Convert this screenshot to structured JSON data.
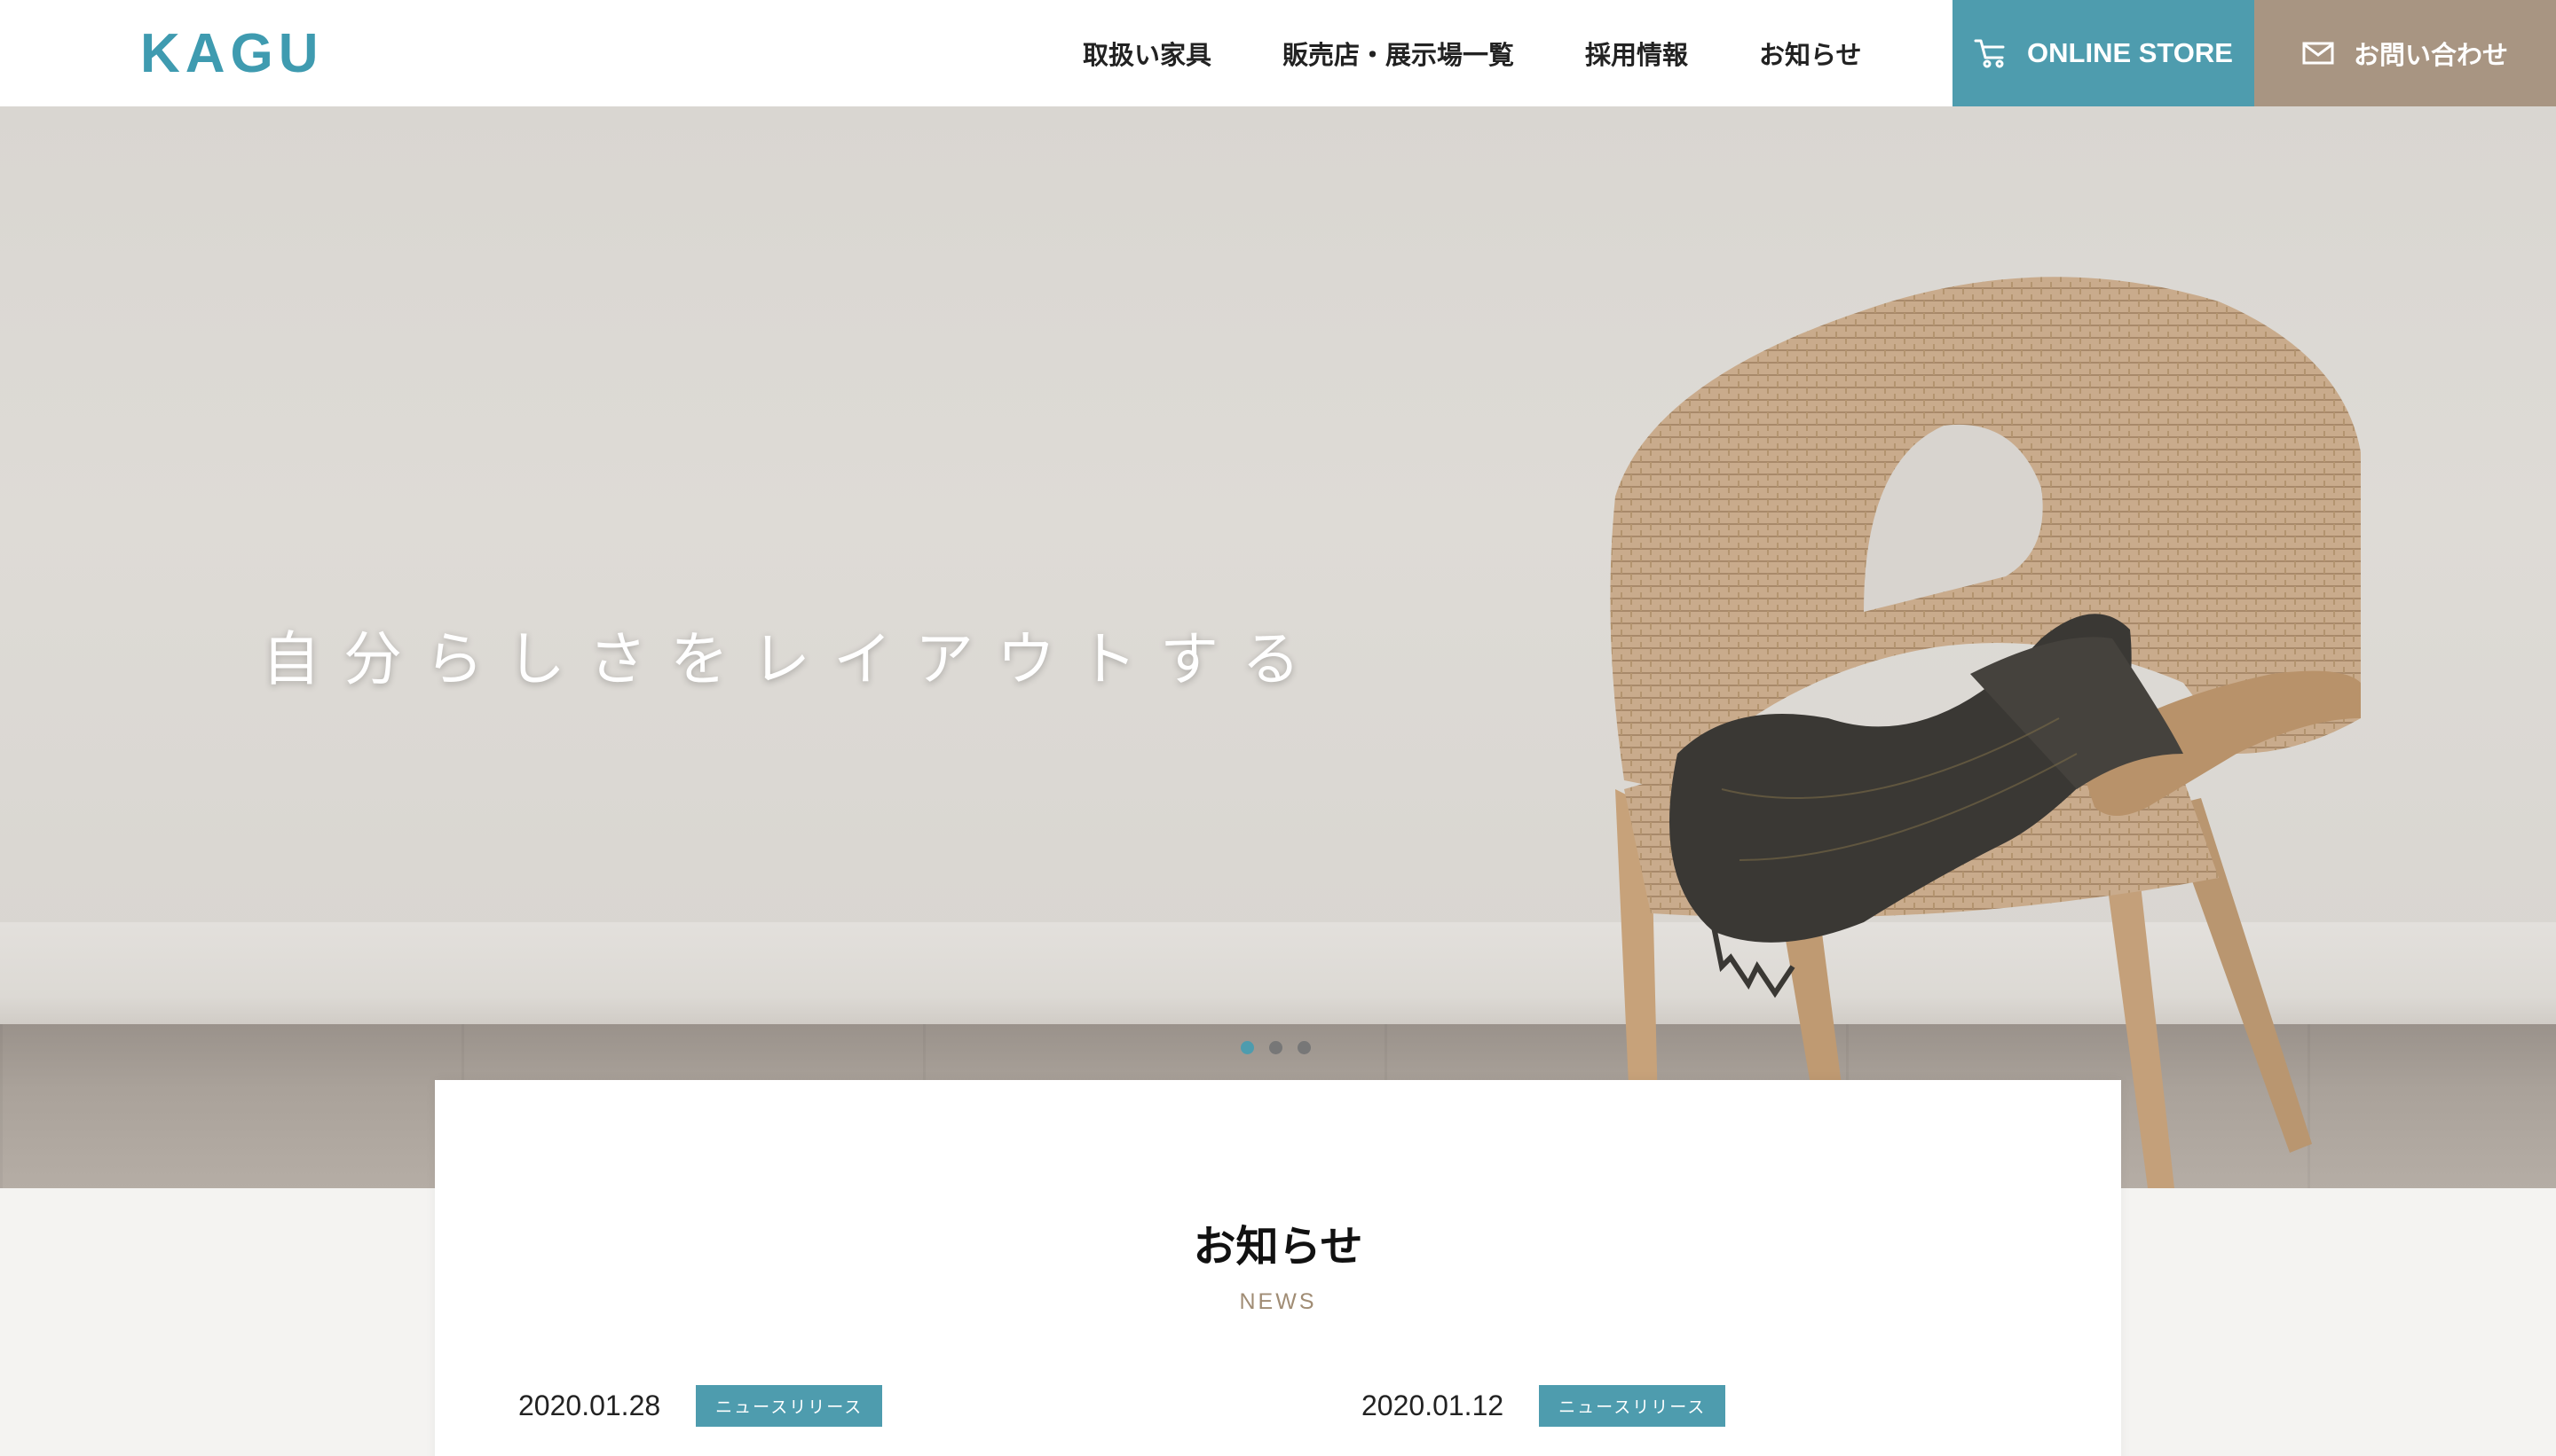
{
  "header": {
    "logo": "KAGU",
    "nav": [
      "取扱い家具",
      "販売店・展示場一覧",
      "採用情報",
      "お知らせ"
    ],
    "store_label": "ONLINE STORE",
    "contact_label": "お問い合わせ"
  },
  "hero": {
    "tagline": "自分らしさをレイアウトする",
    "slides": 3,
    "active_slide": 1
  },
  "news": {
    "title": "お知らせ",
    "subtitle": "NEWS",
    "items": [
      {
        "date": "2020.01.28",
        "tag": "ニュースリリース"
      },
      {
        "date": "2020.01.12",
        "tag": "ニュースリリース"
      }
    ]
  },
  "colors": {
    "accent": "#4e9cae",
    "contact": "#a89582",
    "news_sub": "#a08c74"
  }
}
